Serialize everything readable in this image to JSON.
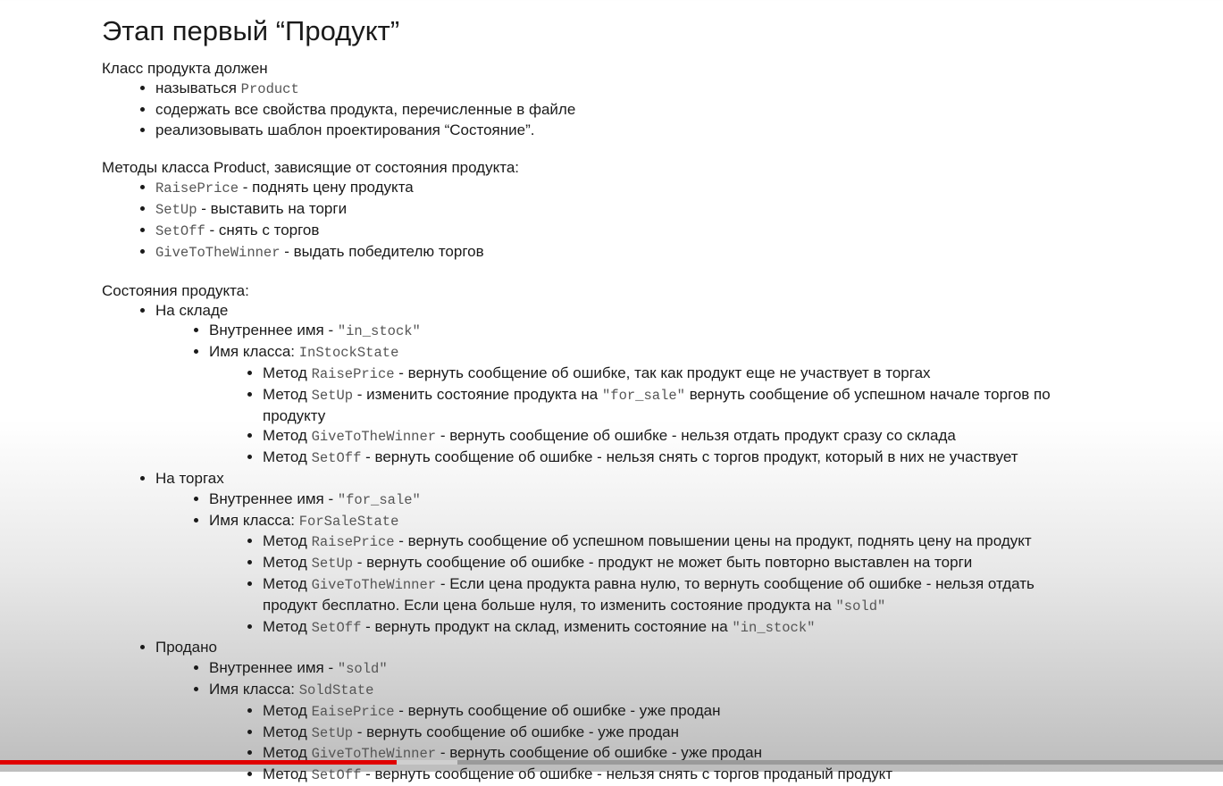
{
  "title": "Этап первый “Продукт”",
  "class_intro": "Класс продукта должен",
  "class_reqs": {
    "r1_text": "называться ",
    "r1_code": "Product",
    "r2_text": "содержать все свойства продукта, перечисленные в файле",
    "r3_text": "реализовывать шаблон проектирования “Состояние”."
  },
  "methods_intro": "Методы класса Product, зависящие от состояния продукта:",
  "methods": {
    "m1_code": "RaisePrice",
    "m1_text": " - поднять цену продукта",
    "m2_code": "SetUp",
    "m2_text": " - выставить на торги",
    "m3_code": "SetOff",
    "m3_text": " - снять с торгов",
    "m4_code": "GiveToTheWinner",
    "m4_text": " - выдать победителю торгов"
  },
  "states_intro": "Состояния продукта:",
  "states": {
    "s1": {
      "label": "На складе",
      "internal_label": "Внутреннее имя - ",
      "internal_code": "\"in_stock\"",
      "class_label": "Имя класса: ",
      "class_code": "InStockState",
      "m1": {
        "pre": "Метод ",
        "code": "RaisePrice",
        "text": " - вернуть сообщение об ошибке, так как продукт еще не участвует в торгах"
      },
      "m2": {
        "pre": "Метод ",
        "code": "SetUp",
        "text1": " - изменить состояние продукта на ",
        "code2": "\"for_sale\"",
        "text2": " вернуть сообщение об успешном начале торгов по продукту"
      },
      "m3": {
        "pre": "Метод ",
        "code": "GiveToTheWinner",
        "text": " - вернуть сообщение об ошибке - нельзя отдать продукт сразу со склада"
      },
      "m4": {
        "pre": "Метод ",
        "code": "SetOff",
        "text": " - вернуть сообщение об ошибке - нельзя снять с торгов продукт, который в них не участвует"
      }
    },
    "s2": {
      "label": "На торгах",
      "internal_label": "Внутреннее имя - ",
      "internal_code": "\"for_sale\"",
      "class_label": "Имя класса: ",
      "class_code": "ForSaleState",
      "m1": {
        "pre": "Метод ",
        "code": "RaisePrice",
        "text": " - вернуть сообщение об успешном повышении цены на продукт, поднять цену на продукт"
      },
      "m2": {
        "pre": "Метод ",
        "code": "SetUp",
        "text": " - вернуть сообщение об ошибке - продукт не может быть повторно выставлен на торги"
      },
      "m3": {
        "pre": "Метод ",
        "code": "GiveToTheWinner",
        "text1": " - Если цена продукта равна нулю, то вернуть сообщение об ошибке - нельзя отдать продукт бесплатно. Если цена больше нуля, то изменить состояние продукта на ",
        "code2": "\"sold\""
      },
      "m4": {
        "pre": "Метод ",
        "code": "SetOff",
        "text1": " - вернуть продукт на склад, изменить состояние на ",
        "code2": "\"in_stock\""
      }
    },
    "s3": {
      "label": "Продано",
      "internal_label": "Внутреннее имя - ",
      "internal_code": "\"sold\"",
      "class_label": "Имя класса: ",
      "class_code": "SoldState",
      "m1": {
        "pre": "Метод ",
        "code": "EaisePrice",
        "text": " - вернуть сообщение об ошибке - уже продан"
      },
      "m2": {
        "pre": "Метод ",
        "code": "SetUp",
        "text": " - вернуть сообщение об ошибке - уже продан"
      },
      "m3": {
        "pre": "Метод ",
        "code": "GiveToTheWinner",
        "text": " - вернуть сообщение об ошибке - уже продан"
      },
      "m4": {
        "pre": "Метод ",
        "code": "SetOff",
        "text": " - вернуть сообщение об ошибке - нельзя снять с торгов проданый продукт"
      }
    }
  },
  "video_progress": {
    "played_fraction": 0.324,
    "buffered_fraction": 0.374,
    "played_color": "#e00000"
  }
}
